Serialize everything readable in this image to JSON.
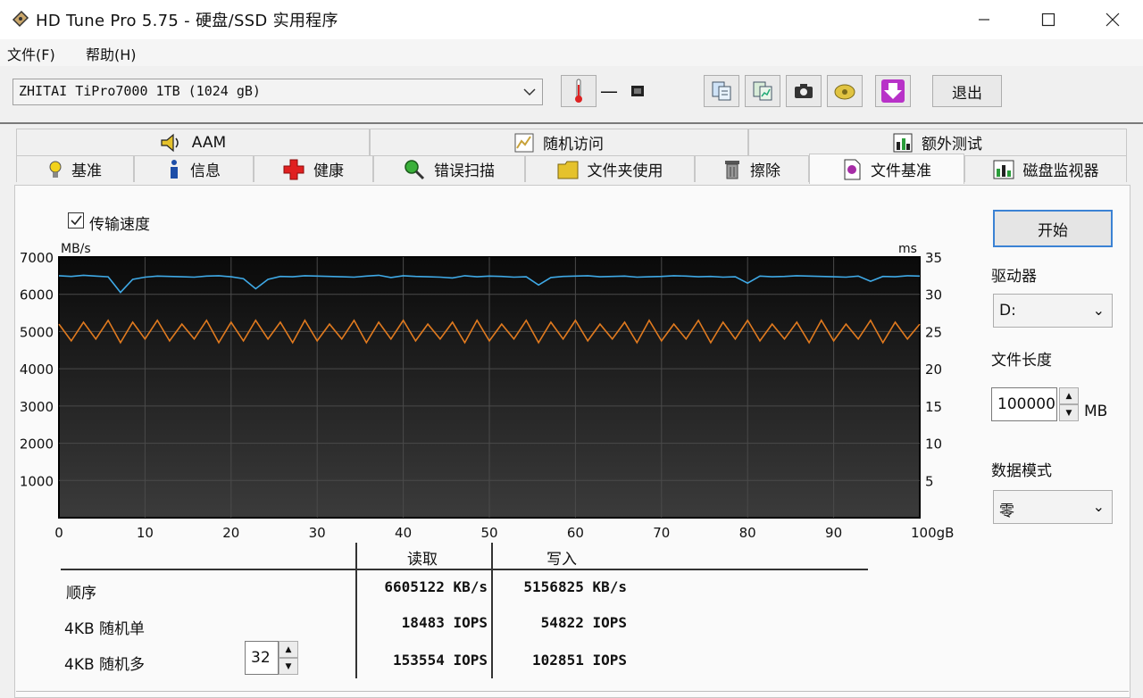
{
  "window": {
    "title": "HD Tune Pro 5.75 - 硬盘/SSD 实用程序"
  },
  "menu": [
    {
      "label": "文件(F)"
    },
    {
      "label": "帮助(H)"
    }
  ],
  "toolbar": {
    "drive": "ZHITAI TiPro7000 1TB (1024 gB)",
    "temperature": "—",
    "exit_label": "退出"
  },
  "tabs_top": [
    {
      "label": "AAM"
    },
    {
      "label": "随机访问"
    },
    {
      "label": "额外测试"
    }
  ],
  "tabs_bottom": [
    {
      "label": "基准"
    },
    {
      "label": "信息"
    },
    {
      "label": "健康"
    },
    {
      "label": "错误扫描"
    },
    {
      "label": "文件夹使用"
    },
    {
      "label": "擦除"
    },
    {
      "label": "文件基准"
    },
    {
      "label": "磁盘监视器"
    }
  ],
  "checkbox": {
    "label": "传输速度",
    "checked": true
  },
  "controls": {
    "start_label": "开始",
    "drive_label": "驱动器",
    "drive_value": "D:",
    "file_length_label": "文件长度",
    "file_length_value": "100000",
    "file_length_unit": "MB",
    "data_mode_label": "数据模式",
    "data_mode_value": "零"
  },
  "chart_data": {
    "type": "line",
    "y_left_unit": "MB/s",
    "y_right_unit": "ms",
    "x_unit": "gB",
    "ylim_left": [
      0,
      7000
    ],
    "ylim_right": [
      0,
      35
    ],
    "xlim": [
      0,
      100
    ],
    "y_left_ticks": [
      "7000",
      "6000",
      "5000",
      "4000",
      "3000",
      "2000",
      "1000"
    ],
    "y_right_ticks": [
      "35",
      "30",
      "25",
      "20",
      "15",
      "10",
      "5"
    ],
    "x_ticks": [
      "0",
      "10",
      "20",
      "30",
      "40",
      "50",
      "60",
      "70",
      "80",
      "90",
      "100gB"
    ],
    "series": [
      {
        "color": "#3fa9e6",
        "values": [
          6500,
          6480,
          6510,
          6490,
          6470,
          6050,
          6400,
          6460,
          6490,
          6480,
          6470,
          6460,
          6490,
          6500,
          6470,
          6420,
          6150,
          6400,
          6480,
          6470,
          6500,
          6490,
          6480,
          6470,
          6460,
          6490,
          6510,
          6450,
          6500,
          6480,
          6470,
          6460,
          6440,
          6500,
          6470,
          6490,
          6480,
          6460,
          6470,
          6250,
          6450,
          6480,
          6490,
          6500,
          6470,
          6480,
          6490,
          6460,
          6470,
          6480,
          6500,
          6490,
          6470,
          6480,
          6460,
          6470,
          6300,
          6490,
          6470,
          6480,
          6500,
          6490,
          6480,
          6470,
          6460,
          6490,
          6350,
          6480,
          6470,
          6500,
          6490
        ]
      },
      {
        "color": "#e07a1f",
        "values": [
          5200,
          4750,
          5250,
          4800,
          5300,
          4700,
          5250,
          4800,
          5300,
          4750,
          5200,
          4800,
          5300,
          4700,
          5250,
          4750,
          5300,
          4800,
          5250,
          4700,
          5300,
          4750,
          5200,
          4800,
          5300,
          4700,
          5250,
          4800,
          5300,
          4750,
          5200,
          4800,
          5250,
          4700,
          5300,
          4750,
          5200,
          4800,
          5300,
          4700,
          5250,
          4800,
          5300,
          4750,
          5200,
          4800,
          5250,
          4700,
          5300,
          4750,
          5200,
          4800,
          5300,
          4700,
          5250,
          4800,
          5300,
          4750,
          5200,
          4800,
          5250,
          4700,
          5300,
          4750,
          5200,
          4800,
          5300,
          4700,
          5250,
          4800,
          5200
        ]
      }
    ]
  },
  "results": {
    "col_read": "读取",
    "col_write": "写入",
    "rows": [
      {
        "label": "顺序",
        "read": "6605122 KB/s",
        "write": "5156825 KB/s"
      },
      {
        "label": "4KB 随机单",
        "read": "18483 IOPS",
        "write": "54822 IOPS"
      },
      {
        "label": "4KB 随机多",
        "read": "153554 IOPS",
        "write": "102851 IOPS"
      }
    ],
    "queue_depth": "32"
  }
}
